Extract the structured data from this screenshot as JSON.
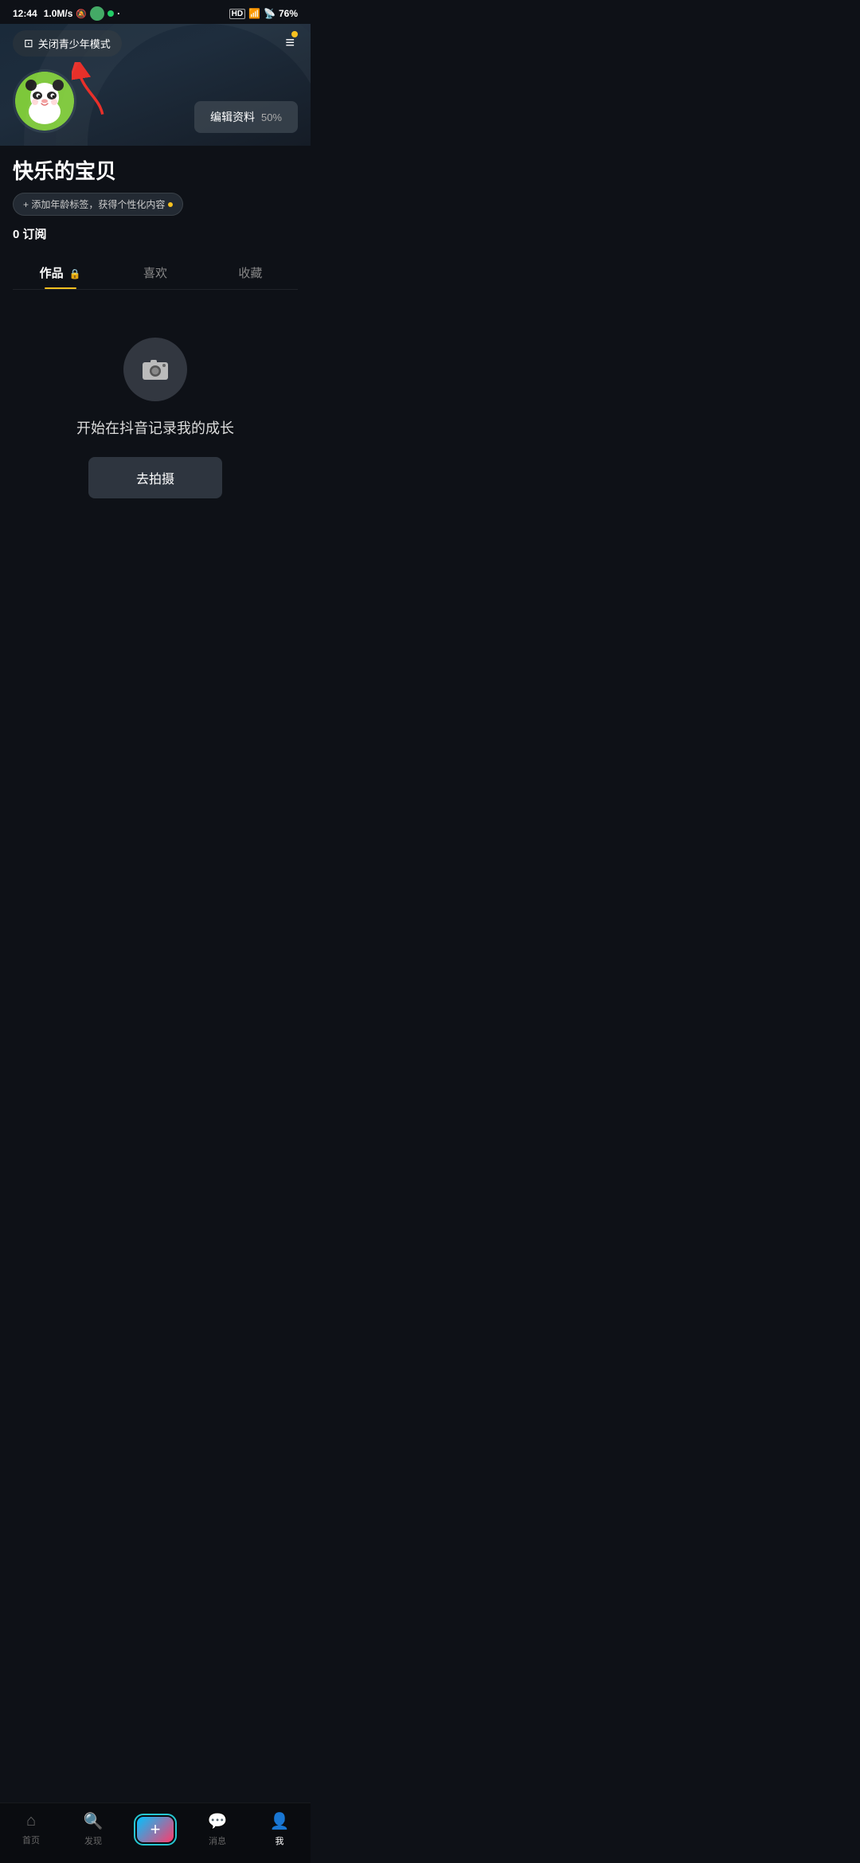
{
  "statusBar": {
    "time": "12:44",
    "network": "1.0M/s",
    "battery": "76%"
  },
  "header": {
    "youthModeLabel": "关闭青少年模式",
    "menuIcon": "≡"
  },
  "profile": {
    "username": "快乐的宝贝",
    "editLabel": "编辑资料",
    "editProgress": "50%",
    "ageTagLabel": "+ 添加年龄标签，获得个性化内容",
    "subscribeCount": "0",
    "subscribeLabel": "订阅"
  },
  "tabs": [
    {
      "label": "作品",
      "locked": true,
      "active": true
    },
    {
      "label": "喜欢",
      "locked": false,
      "active": false
    },
    {
      "label": "收藏",
      "locked": false,
      "active": false
    }
  ],
  "emptyState": {
    "title": "开始在抖音记录我的成长",
    "shootLabel": "去拍摄"
  },
  "bottomNav": [
    {
      "label": "首页",
      "active": false
    },
    {
      "label": "发现",
      "active": false
    },
    {
      "label": "+",
      "active": false,
      "isAdd": true
    },
    {
      "label": "消息",
      "active": false
    },
    {
      "label": "我",
      "active": true
    }
  ]
}
